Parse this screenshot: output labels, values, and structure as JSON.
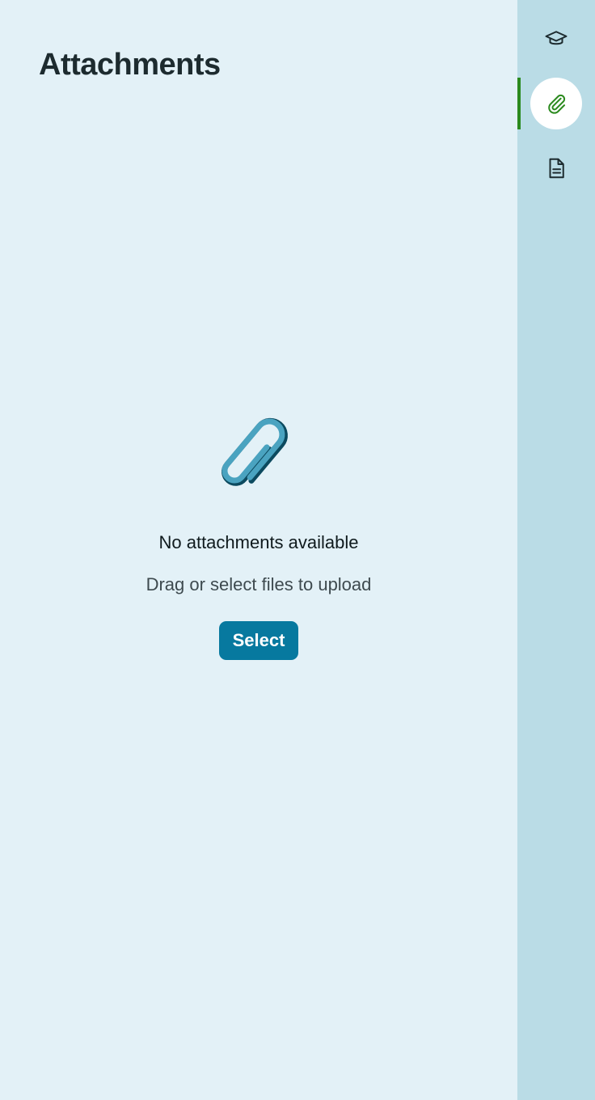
{
  "page": {
    "title": "Attachments"
  },
  "empty_state": {
    "icon": "paperclip-icon",
    "title": "No attachments available",
    "subtitle": "Drag or select files to upload",
    "button_label": "Select"
  },
  "sidebar": {
    "items": [
      {
        "icon": "graduation-cap-icon",
        "active": false
      },
      {
        "icon": "paperclip-icon",
        "active": true
      },
      {
        "icon": "document-icon",
        "active": false
      }
    ]
  },
  "colors": {
    "background": "#e3f1f7",
    "rail_background": "#badce6",
    "primary_button": "#07799f",
    "active_indicator": "#2b8a1e",
    "icon_light": "#4aa3c0",
    "icon_dark": "#0c4a5f"
  }
}
